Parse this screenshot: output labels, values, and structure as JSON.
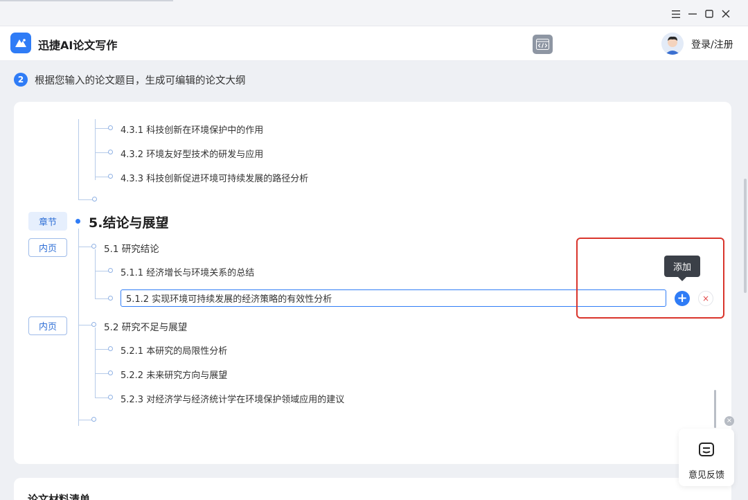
{
  "window": {
    "menu_icon": "menu-icon",
    "min_icon": "minimize-icon",
    "max_icon": "maximize-icon",
    "close_icon": "close-icon"
  },
  "header": {
    "app_title": "迅捷AI论文写作",
    "login_label": "登录/注册",
    "code_icon": "code-icon"
  },
  "step": {
    "number": "2",
    "text": "根据您输入的论文题目，生成可编辑的论文大纲"
  },
  "outline": {
    "items_top": [
      "4.3.1 科技创新在环境保护中的作用",
      "4.3.2 环境友好型技术的研发与应用",
      "4.3.3 科技创新促进环境可持续发展的路径分析"
    ],
    "chapter_tag": "章节",
    "chapter_title": "5.结论与展望",
    "section1_tag": "内页",
    "section1_title": "5.1 研究结论",
    "item_511": "5.1.1 经济增长与环境关系的总结",
    "edit_value": "5.1.2 实现环境可持续发展的经济策略的有效性分析",
    "section2_tag": "内页",
    "section2_title": "5.2 研究不足与展望",
    "items_bottom": [
      "5.2.1 本研究的局限性分析",
      "5.2.2 未来研究方向与展望",
      "5.2.3 对经济学与经济统计学在环境保护领域应用的建议"
    ]
  },
  "actions": {
    "tooltip": "添加",
    "add_symbol": "+",
    "delete_symbol": "×"
  },
  "feedback": {
    "label": "意见反馈",
    "close_symbol": "×"
  },
  "next_card_title": "论文材料清单",
  "colors": {
    "accent": "#2f7cf6",
    "highlight_border": "#d9342b",
    "tree_line": "#b6cbe9"
  }
}
